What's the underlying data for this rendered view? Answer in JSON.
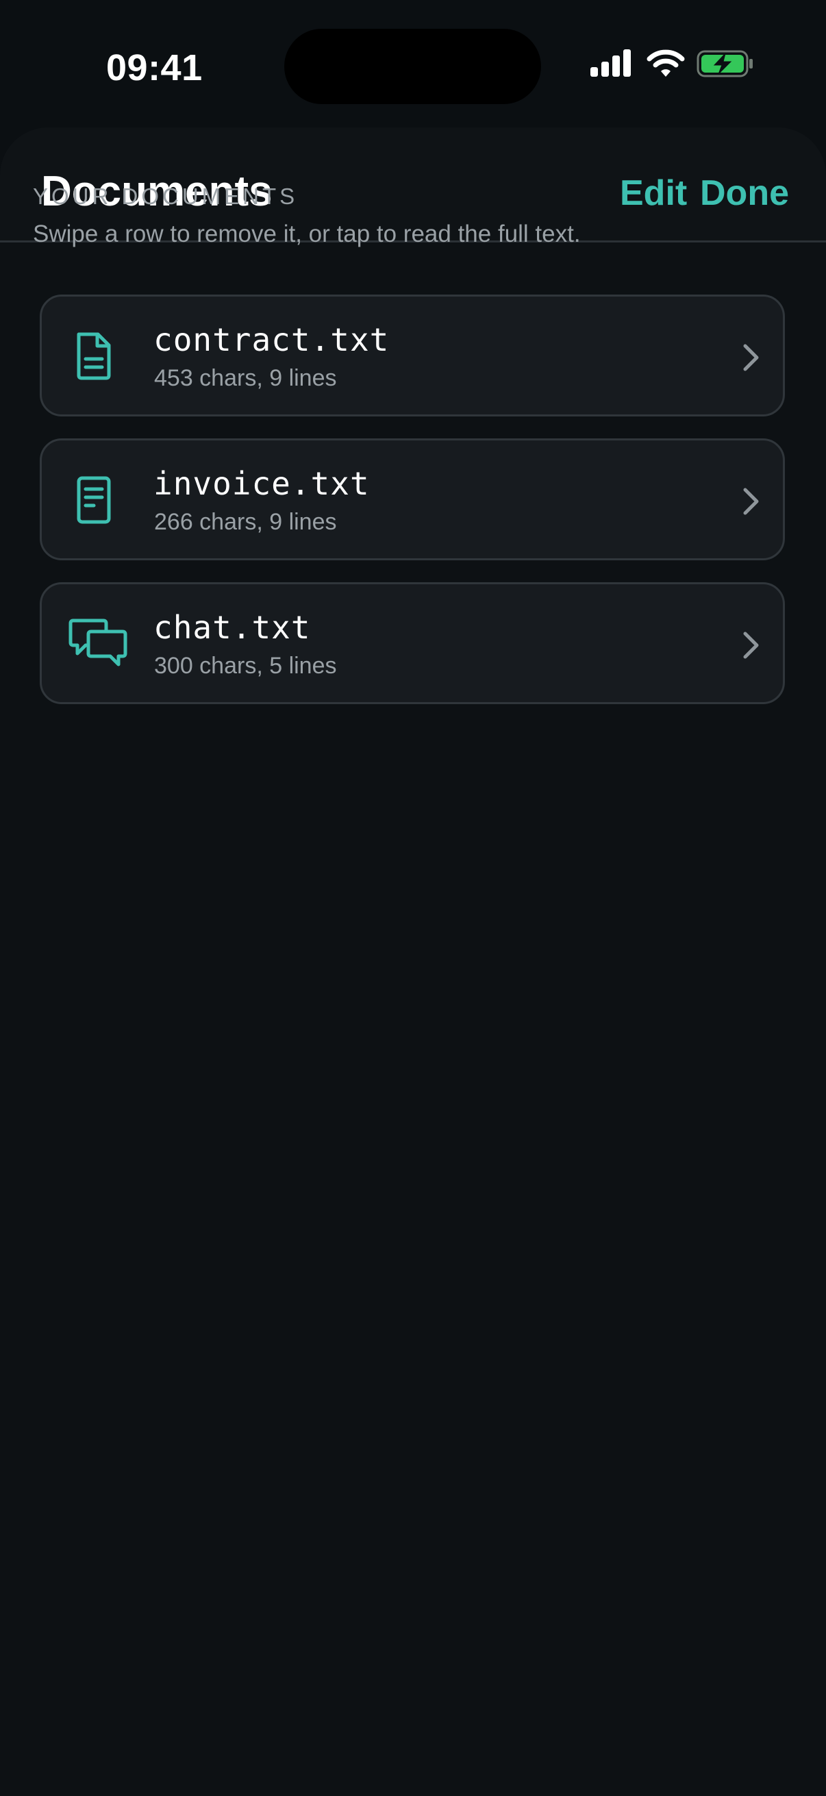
{
  "status_bar": {
    "time": "09:41",
    "icons": [
      "cellular-signal-icon",
      "wifi-icon",
      "battery-charging-icon"
    ]
  },
  "nav": {
    "title": "Documents",
    "edit_label": "Edit",
    "done_label": "Done"
  },
  "section": {
    "title": "YOUR DOCUMENTS",
    "subtitle": "Swipe a row to remove it, or tap to read the full text."
  },
  "documents": [
    {
      "name": "contract.txt",
      "meta": "453 chars, 9 lines",
      "icon": "document-icon"
    },
    {
      "name": "invoice.txt",
      "meta": "266 chars, 9 lines",
      "icon": "receipt-icon"
    },
    {
      "name": "chat.txt",
      "meta": "300 chars, 5 lines",
      "icon": "chat-bubbles-icon"
    }
  ],
  "colors": {
    "accent": "#3ec0b1",
    "background": "#0b0f12",
    "card": "#171b1f",
    "battery": "#34c759"
  }
}
